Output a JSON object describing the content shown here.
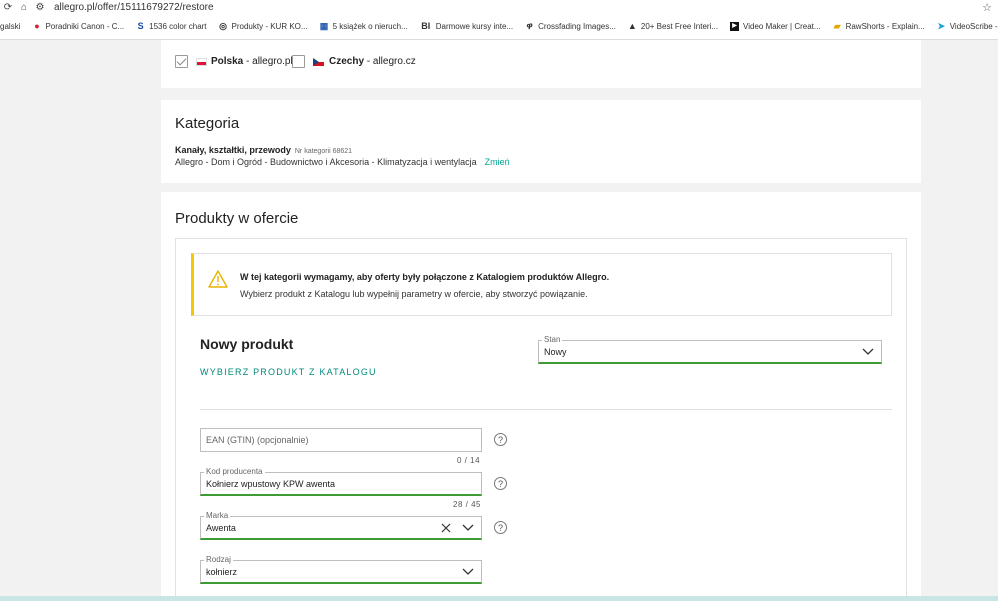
{
  "browser": {
    "url": "allegro.pl/offer/15111679272/restore",
    "bookmarks": [
      {
        "label": "galski",
        "icon": "bookmark-icon"
      },
      {
        "label": "Poradniki Canon - C...",
        "icon": "canon-dot-icon"
      },
      {
        "label": "1536 color chart",
        "icon": "s-logo-icon"
      },
      {
        "label": "Produkty - KUR KO...",
        "icon": "globe-icon"
      },
      {
        "label": "5 książek o nieruch...",
        "icon": "page-icon"
      },
      {
        "label": "Darmowe kursy inte...",
        "icon": "bi-logo-icon"
      },
      {
        "label": "Crossfading Images...",
        "icon": "link-icon"
      },
      {
        "label": "20+ Best Free Interi...",
        "icon": "house-icon"
      },
      {
        "label": "Video Maker | Creat...",
        "icon": "play-icon"
      },
      {
        "label": "RawShorts - Explain...",
        "icon": "chat-icon"
      },
      {
        "label": "VideoScribe - White...",
        "icon": "arrow-icon"
      }
    ]
  },
  "markets": {
    "pl": {
      "name": "Polska",
      "domain": " - allegro.pl",
      "checked": true
    },
    "cz": {
      "name": "Czechy",
      "domain": " - allegro.cz",
      "checked": false
    }
  },
  "category": {
    "heading": "Kategoria",
    "name": "Kanały, kształtki, przewody",
    "nr": "Nr kategorii 68621",
    "path": "Allegro - Dom i Ogród - Budownictwo i Akcesoria - Klimatyzacja i wentylacja",
    "change_link": "Zmień"
  },
  "products": {
    "heading": "Produkty w ofercie",
    "alert_title": "W tej kategorii wymagamy, aby oferty były połączone z Katalogiem produktów Allegro.",
    "alert_text": "Wybierz produkt z Katalogu lub wypełnij parametry w ofercie, aby stworzyć powiązanie.",
    "new_product_title": "Nowy produkt",
    "choose_from_catalog": "WYBIERZ PRODUKT Z KATALOGU",
    "stan": {
      "label": "Stan",
      "value": "Nowy"
    },
    "ean": {
      "placeholder": "EAN (GTIN) (opcjonalnie)",
      "counter": "0 / 14"
    },
    "kod": {
      "label": "Kod producenta",
      "value": "Kołnierz wpustowy KPW awenta",
      "counter": "28 / 45"
    },
    "marka": {
      "label": "Marka",
      "value": "Awenta"
    },
    "rodzaj": {
      "label": "Rodzaj",
      "value": "kołnierz"
    }
  },
  "colors": {
    "accent": "#00a790",
    "field_underline": "#3f9c35",
    "warning": "#f6c700"
  }
}
